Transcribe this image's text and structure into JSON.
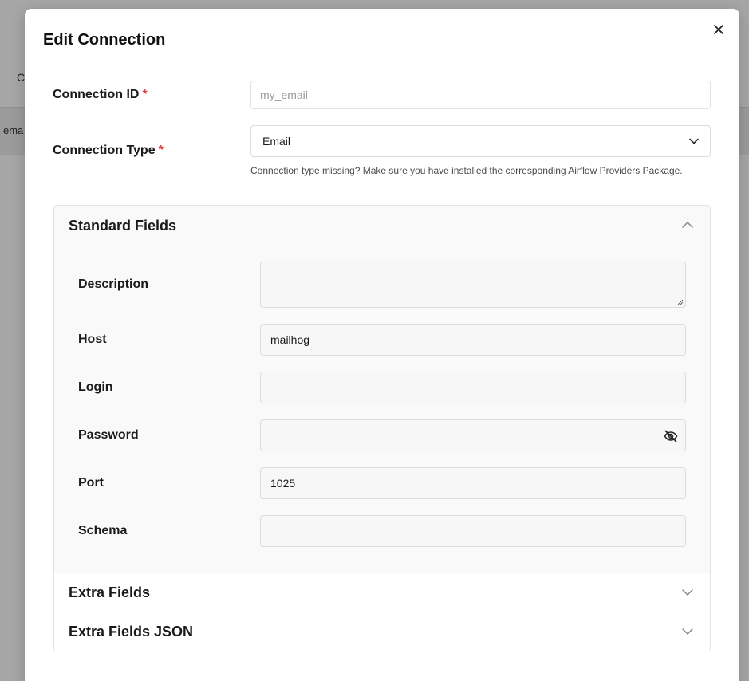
{
  "background": {
    "text_top": "Co",
    "text_band": "ema"
  },
  "modal": {
    "title": "Edit Connection",
    "close_icon": "close-icon"
  },
  "connection_id": {
    "label": "Connection ID",
    "required_mark": "*",
    "value": "my_email"
  },
  "connection_type": {
    "label": "Connection Type",
    "required_mark": "*",
    "selected": "Email",
    "helper": "Connection type missing? Make sure you have installed the corresponding Airflow Providers Package."
  },
  "standard_fields": {
    "title": "Standard Fields",
    "fields": {
      "description": {
        "label": "Description",
        "value": ""
      },
      "host": {
        "label": "Host",
        "value": "mailhog"
      },
      "login": {
        "label": "Login",
        "value": ""
      },
      "password": {
        "label": "Password",
        "value": "",
        "icon": "eye-off-icon"
      },
      "port": {
        "label": "Port",
        "value": "1025"
      },
      "schema": {
        "label": "Schema",
        "value": ""
      }
    }
  },
  "extra_fields": {
    "title": "Extra Fields"
  },
  "extra_fields_json": {
    "title": "Extra Fields JSON"
  },
  "colors": {
    "required": "#e53e3e",
    "overlay": "#a8a8a8",
    "section_bg": "#f9f9f9"
  }
}
